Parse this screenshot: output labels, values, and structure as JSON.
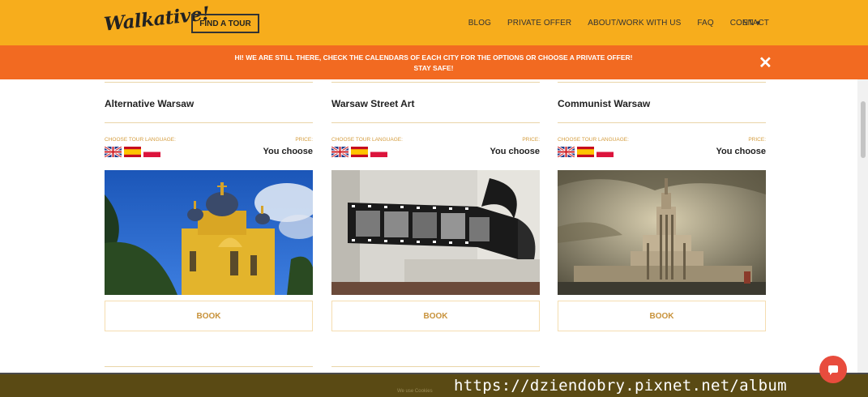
{
  "header": {
    "logo_text": "Walkative!",
    "find_tour_label": "FIND A TOUR",
    "nav": [
      "BLOG",
      "PRIVATE OFFER",
      "ABOUT/WORK WITH US",
      "FAQ",
      "CONTACT"
    ],
    "language": "EN",
    "colors": {
      "bar": "#f7ad1c"
    }
  },
  "banner": {
    "line1": "HI! WE ARE STILL THERE, CHECK THE CALENDARS OF EACH CITY FOR THE OPTIONS OR CHOOSE A PRIVATE OFFER!",
    "line2": "STAY SAFE!",
    "close_icon": "close-icon",
    "color": "#f26a21"
  },
  "tours": [
    {
      "title": "Alternative Warsaw",
      "lang_label": "CHOOSE TOUR LANGUAGE:",
      "price_label": "PRICE:",
      "price": "You choose",
      "flags": [
        "uk-flag",
        "spain-flag",
        "poland-flag"
      ],
      "book_label": "BOOK",
      "image": "cathedral-photo"
    },
    {
      "title": "Warsaw Street Art",
      "lang_label": "CHOOSE TOUR LANGUAGE:",
      "price_label": "PRICE:",
      "price": "You choose",
      "flags": [
        "uk-flag",
        "spain-flag",
        "poland-flag"
      ],
      "book_label": "BOOK",
      "image": "film-strip-mural-photo"
    },
    {
      "title": "Communist Warsaw",
      "lang_label": "CHOOSE TOUR LANGUAGE:",
      "price_label": "PRICE:",
      "price": "You choose",
      "flags": [
        "uk-flag",
        "spain-flag",
        "poland-flag"
      ],
      "book_label": "BOOK",
      "image": "palace-of-culture-photo"
    }
  ],
  "footer": {
    "cookie_text": "We use Cookies",
    "watermark": "https://dziendobry.pixnet.net/album",
    "chat_icon": "chat-icon"
  }
}
